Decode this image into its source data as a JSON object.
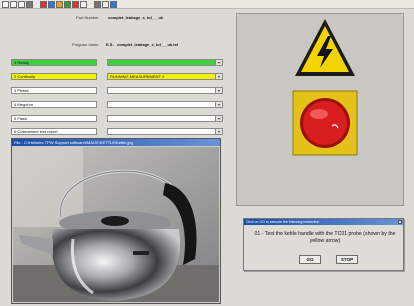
{
  "toolbar": {
    "icons": [
      "new-icon",
      "save-icon",
      "print-icon",
      "open-icon",
      "cut-icon",
      "copy-icon",
      "paste-icon",
      "chart-icon",
      "flag-icon",
      "search-icon",
      "tool-icon",
      "settings-icon",
      "help-icon"
    ]
  },
  "info": {
    "part_number_label": "Part Number",
    "part_number_value": "complet_leakage_s_tol___uk",
    "program_name_label": "Program name",
    "program_name_prefix": "E.S.",
    "program_name_value": "complet_leakage_s_tol___uk.txt"
  },
  "fields": {
    "row1_left": "1 Ready",
    "row1_right": "",
    "row2_left": "2 Continuity",
    "row2_right": "RUNNING MEASUREMENT X",
    "row3_left": "3 Phase",
    "row3_right": "",
    "row4_left": "4 Megohm",
    "row4_right": "",
    "row5_left": "5 Flash",
    "row5_right": "",
    "row6_left": "6 Customised test report",
    "row6_right": ""
  },
  "video": {
    "title": "File - C:\\Hellotec TPW Support software\\IMAGE\\KETTLE\\Kettle.jpg"
  },
  "colors": {
    "ok": "#3fcf3f",
    "running": "#f2f200",
    "warning": "#f3d400",
    "stop": "#d81e1e"
  },
  "dialog": {
    "title": "Click on GO to execute the following instruction",
    "message": "01 - Test the kettle handle with the TC01 probe (shown by the yellow arrow)",
    "go_label": "GO",
    "stop_label": "STOP"
  }
}
